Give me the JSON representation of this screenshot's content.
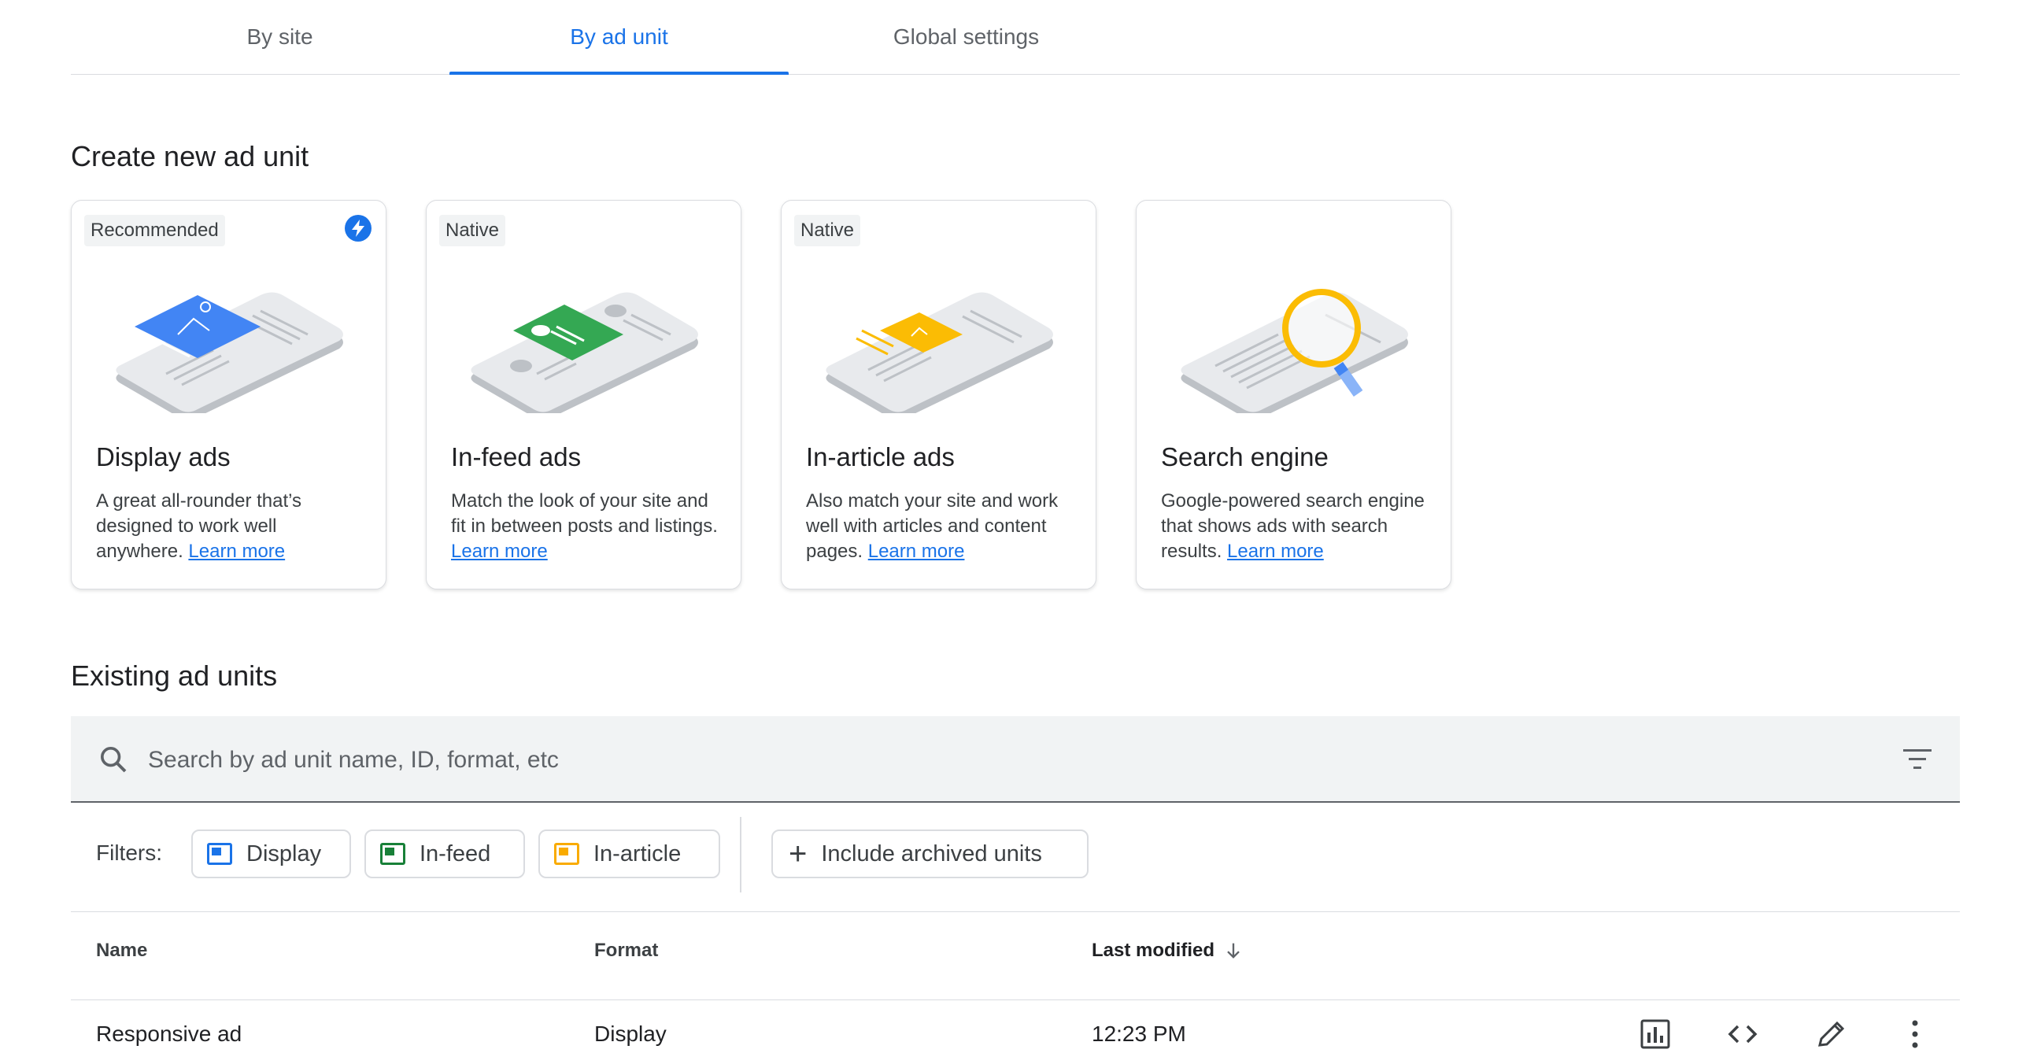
{
  "tabs": [
    {
      "label": "By site",
      "active": false
    },
    {
      "label": "By ad unit",
      "active": true
    },
    {
      "label": "Global settings",
      "active": false
    }
  ],
  "create_section": {
    "title": "Create new ad unit"
  },
  "cards": [
    {
      "badge": "Recommended",
      "title": "Display ads",
      "desc": "A great all-rounder that’s designed to work well anywhere.",
      "link": "Learn more",
      "icon": "lightning-bolt-icon",
      "accent": "#4285f4"
    },
    {
      "badge": "Native",
      "title": "In-feed ads",
      "desc": "Match the look of your site and fit in between posts and listings.",
      "link": "Learn more",
      "accent": "#34a853"
    },
    {
      "badge": "Native",
      "title": "In-article ads",
      "desc": "Also match your site and work well with articles and content pages.",
      "link": "Learn more",
      "accent": "#fbbc04"
    },
    {
      "badge": "",
      "title": "Search engine",
      "desc": "Google-powered search engine that shows ads with search results.",
      "link": "Learn more",
      "accent": "#fbbc04"
    }
  ],
  "existing_section": {
    "title": "Existing ad units"
  },
  "search": {
    "placeholder": "Search by ad unit name, ID, format, etc",
    "value": ""
  },
  "filters": {
    "label": "Filters:",
    "chips": [
      {
        "label": "Display",
        "color": "#1a73e8"
      },
      {
        "label": "In-feed",
        "color": "#188038"
      },
      {
        "label": "In-article",
        "color": "#f9ab00"
      }
    ],
    "archived_label": "Include archived units"
  },
  "table": {
    "columns": [
      "Name",
      "Format",
      "Last modified"
    ],
    "sort_icon": "arrow-down-icon",
    "rows": [
      {
        "name": "Responsive ad",
        "format": "Display",
        "modified": "12:23 PM"
      }
    ],
    "row_actions": [
      "bar-chart-icon",
      "code-icon",
      "pencil-icon",
      "more-vert-icon"
    ]
  }
}
